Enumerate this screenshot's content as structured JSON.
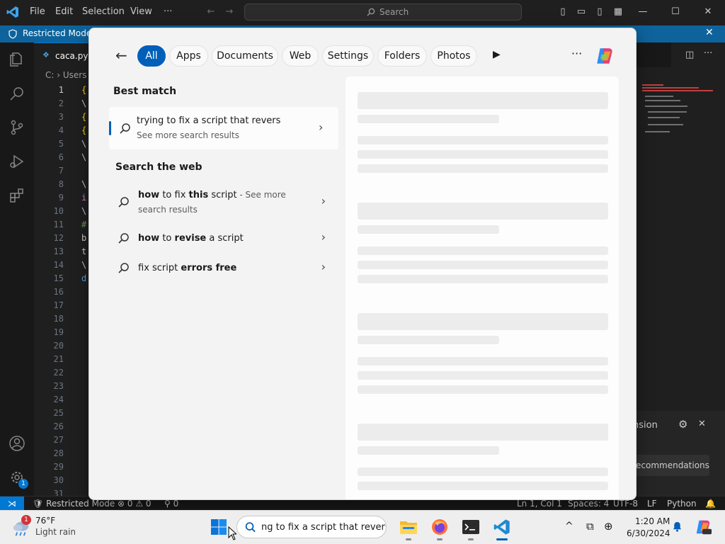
{
  "vscode": {
    "menu": [
      "File",
      "Edit",
      "Selection",
      "View",
      "···"
    ],
    "search_placeholder": "Search",
    "banner": "Restricted Mode i",
    "tab": "caca.py",
    "breadcrumb": "C: › Users",
    "line_numbers": [
      "1",
      "2",
      "3",
      "4",
      "5",
      "6",
      "7",
      "8",
      "9",
      "10",
      "11",
      "12",
      "13",
      "14",
      "15",
      "16",
      "17",
      "18",
      "19",
      "20",
      "21",
      "22",
      "23",
      "24",
      "25",
      "26",
      "27",
      "28",
      "29",
      "30",
      "31"
    ],
    "code_fragments": [
      "{",
      "\\",
      "{",
      "{",
      "\\",
      "\\",
      "",
      "\\",
      "i",
      "\\",
      "#",
      "b",
      "t",
      "\\",
      "d"
    ],
    "extension_panel": {
      "title": "nsion",
      "button": "ecommendations"
    },
    "status": {
      "mode": "Restricted Mode",
      "problems": "⊗ 0 ⚠ 0",
      "ports": "⚲ 0",
      "position": "Ln 1, Col 1",
      "spaces": "Spaces: 4",
      "encoding": "UTF-8",
      "eol": "LF",
      "language": "Python"
    },
    "badge_count": "1"
  },
  "flyout": {
    "tabs": [
      "All",
      "Apps",
      "Documents",
      "Web",
      "Settings",
      "Folders",
      "Photos"
    ],
    "best_match_header": "Best match",
    "best_match": {
      "title": "trying to fix a script that revers",
      "subtitle": "See more search results"
    },
    "web_header": "Search the web",
    "web_results": [
      {
        "pre": "how",
        "mid": " to fix ",
        "bold": "this",
        "post": " script",
        "suffix": " - See more",
        "line2": "search results"
      },
      {
        "pre": "how",
        "mid": " to ",
        "bold": "revise",
        "post": " a script",
        "suffix": "",
        "line2": ""
      },
      {
        "pre": "",
        "mid": "fix script ",
        "bold": "errors free",
        "post": "",
        "suffix": "",
        "line2": ""
      }
    ]
  },
  "taskbar": {
    "weather_temp": "76°F",
    "weather_desc": "Light rain",
    "weather_badge": "1",
    "search_text": "ng to fix a script that revers",
    "time": "1:20 AM",
    "date": "6/30/2024"
  },
  "colors": {
    "accent": "#005fb8",
    "vscode_blue": "#0078d4"
  }
}
